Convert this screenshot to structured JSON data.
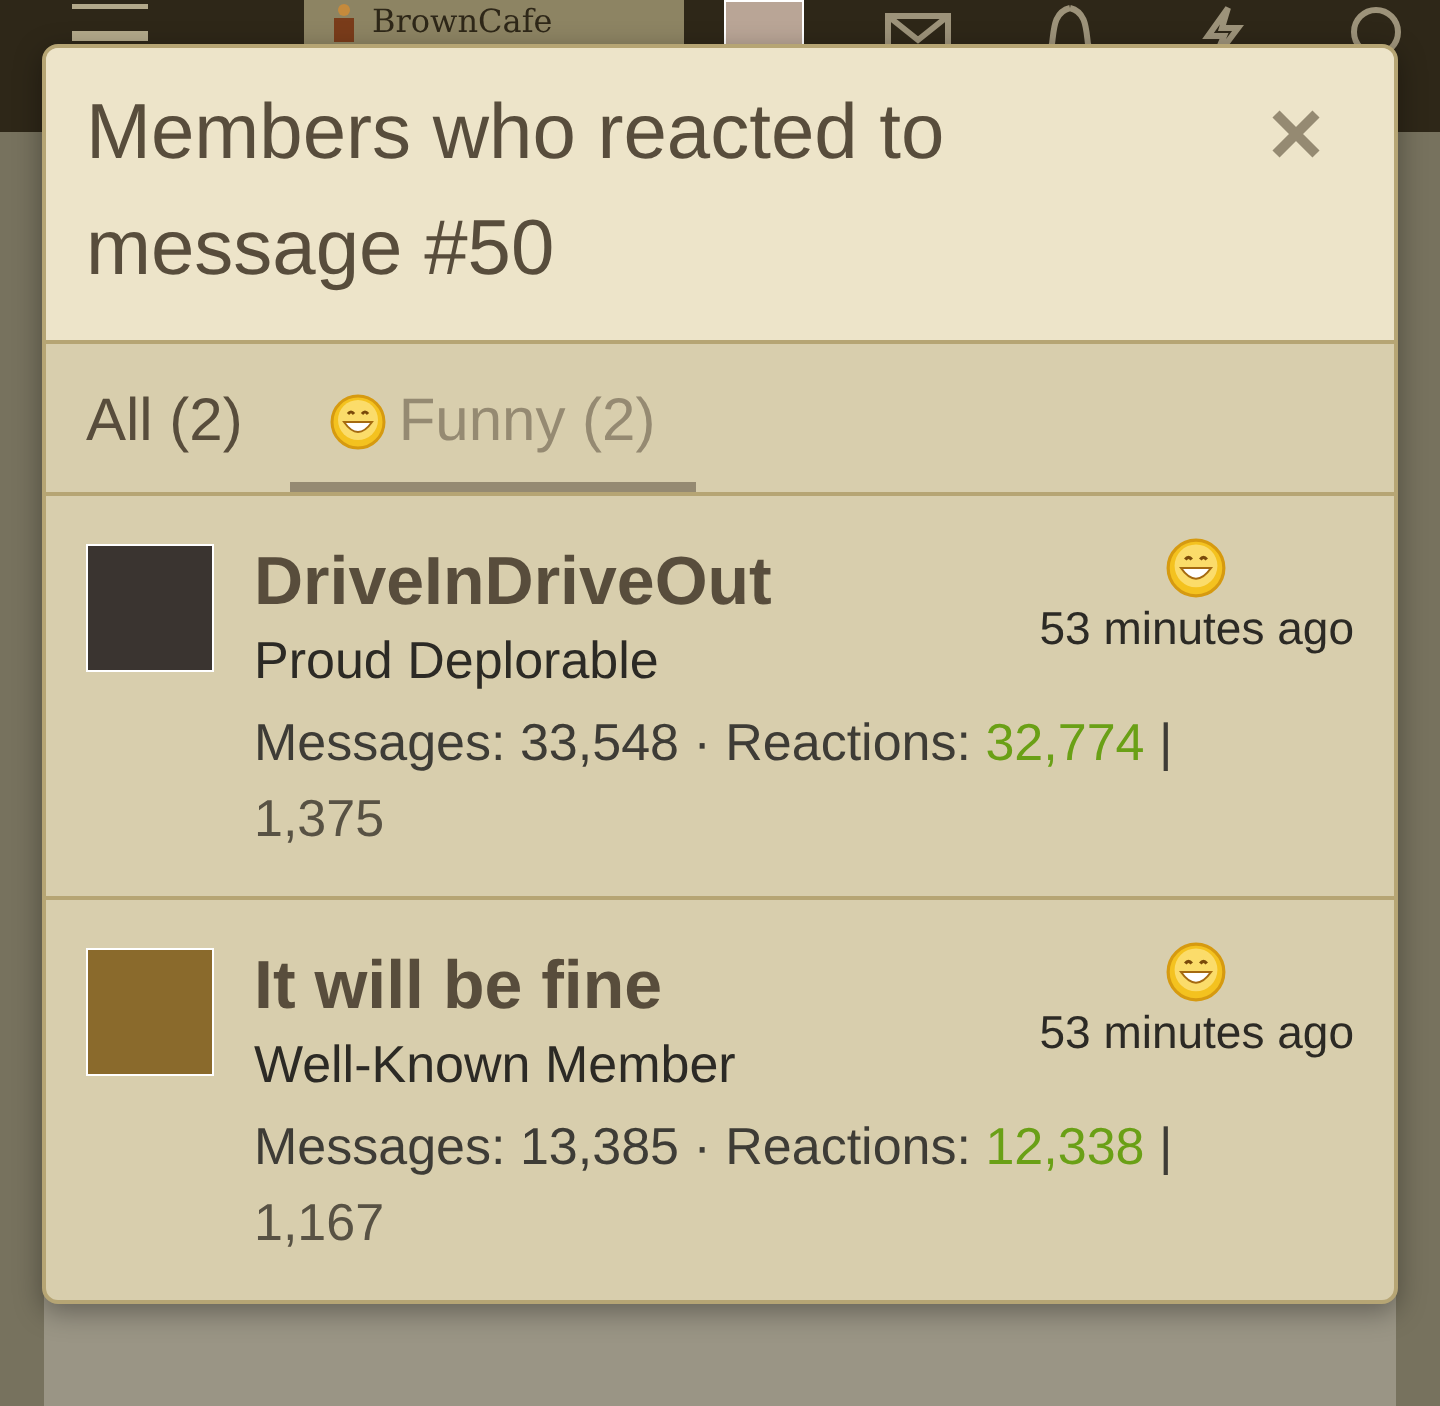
{
  "header": {
    "logo_text": "BrownCafe"
  },
  "dialog": {
    "title": "Members who reacted to message #50",
    "tabs": [
      {
        "label": "All (2)",
        "selected": false,
        "kind": "plain"
      },
      {
        "label": "Funny (2)",
        "selected": true,
        "kind": "reaction"
      }
    ],
    "members": [
      {
        "name": "DriveInDriveOut",
        "title": "Proud Deplorable",
        "time": "53 minutes ago",
        "messages_label": "Messages:",
        "messages": "33,548",
        "separator": "·",
        "reactions_label": "Reactions:",
        "reactions": "32,774",
        "divider": "|",
        "points": "1,375"
      },
      {
        "name": "It will be fine",
        "title": "Well-Known Member",
        "time": "53 minutes ago",
        "messages_label": "Messages:",
        "messages": "13,385",
        "separator": "·",
        "reactions_label": "Reactions:",
        "reactions": "12,338",
        "divider": "|",
        "points": "1,167"
      }
    ]
  }
}
